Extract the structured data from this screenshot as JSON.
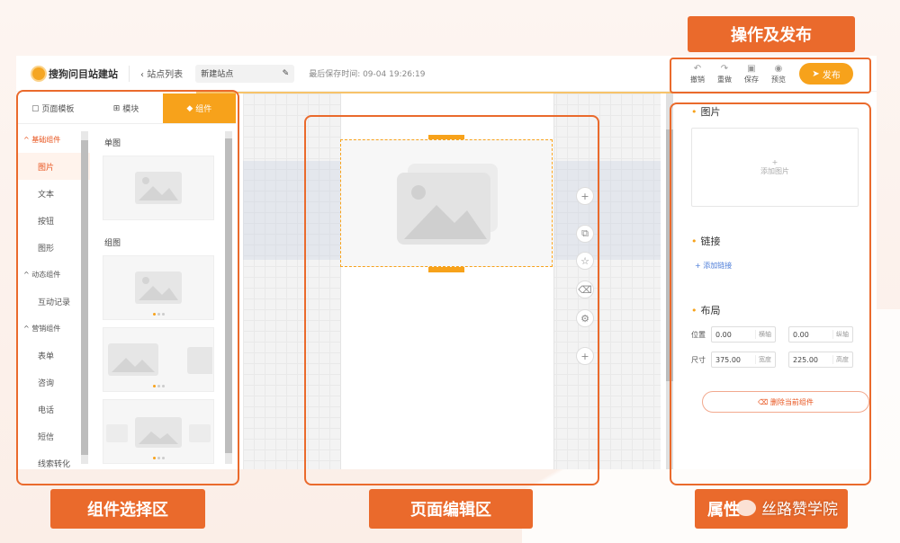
{
  "header": {
    "logo": "搜狗问目站建站",
    "back": "站点列表",
    "site_name": "新建站点",
    "save_time": "最后保存时间: 09-04 19:26:19",
    "actions": [
      {
        "icon": "undo-icon",
        "label": "撤销"
      },
      {
        "icon": "redo-icon",
        "label": "重做"
      },
      {
        "icon": "save-icon",
        "label": "保存"
      },
      {
        "icon": "preview-icon",
        "label": "预览"
      }
    ],
    "publish": "发布"
  },
  "left": {
    "tabs": [
      "页面模板",
      "模块",
      "组件"
    ],
    "categories": [
      {
        "title": "基础组件",
        "items": [
          "图片",
          "文本",
          "按钮",
          "图形"
        ]
      },
      {
        "title": "动态组件",
        "items": [
          "互动记录"
        ]
      },
      {
        "title": "营销组件",
        "items": [
          "表单",
          "咨询",
          "电话",
          "短信",
          "线索转化"
        ]
      }
    ],
    "components": [
      "单图",
      "组图"
    ]
  },
  "right": {
    "image_title": "图片",
    "add_image": "添加图片",
    "link_title": "链接",
    "add_link": "添加链接",
    "layout_title": "布局",
    "position_label": "位置",
    "size_label": "尺寸",
    "pos_x": "0.00",
    "pos_x_unit": "横轴",
    "pos_y": "0.00",
    "pos_y_unit": "纵轴",
    "width": "375.00",
    "width_unit": "宽度",
    "height": "225.00",
    "height_unit": "高度",
    "delete": "删除当前组件"
  },
  "annotations": {
    "publish_area": "操作及发布",
    "component_area": "组件选择区",
    "edit_area": "页面编辑区",
    "property_area": "属性"
  },
  "watermark": "丝路赞学院",
  "colors": {
    "accent": "#f7a21b",
    "annotation": "#ea6a2c"
  }
}
